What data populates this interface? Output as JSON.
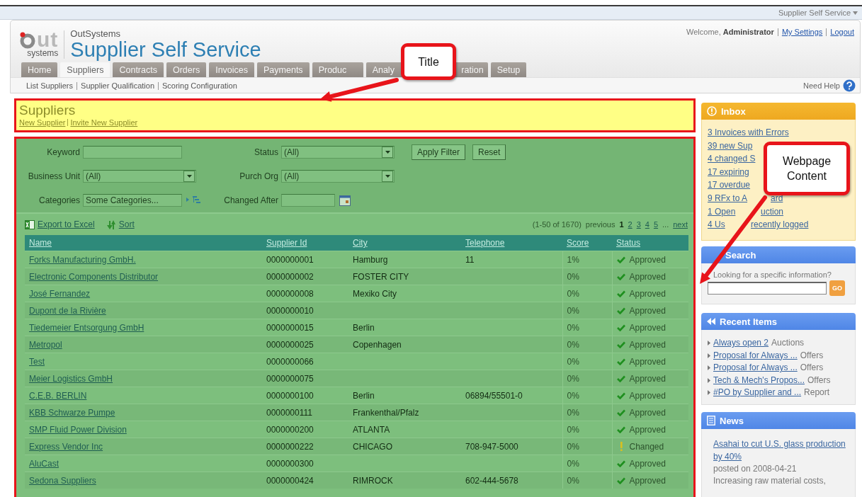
{
  "app_switcher": {
    "label": "Supplier Self Service"
  },
  "logo": {
    "mark": "ut",
    "caption": "systems"
  },
  "company": "OutSystems",
  "app_title": "Supplier Self Service",
  "user_bar": {
    "greeting": "Welcome,",
    "user": "Administrator",
    "links": [
      "My Settings",
      "Logout"
    ]
  },
  "tabs": [
    {
      "label": "Home",
      "selected": false
    },
    {
      "label": "Suppliers",
      "selected": true
    },
    {
      "label": "Contracts",
      "selected": false
    },
    {
      "label": "Orders",
      "selected": false
    },
    {
      "label": "Invoices",
      "selected": false
    },
    {
      "label": "Payments",
      "selected": false
    },
    {
      "label": "Produc",
      "selected": false,
      "kind": "cut_end"
    },
    {
      "label": "Analy",
      "selected": false,
      "kind": "cut_end"
    },
    {
      "label": "ration",
      "selected": false,
      "kind": "cut_start"
    },
    {
      "label": "Setup",
      "selected": false
    }
  ],
  "subnav": [
    "List Suppliers",
    "Supplier Qualification",
    "Scoring Configuration"
  ],
  "help": {
    "label": "Need Help"
  },
  "page": {
    "title": "Suppliers",
    "actions": [
      "New Supplier",
      "Invite New Supplier"
    ]
  },
  "filters": [
    {
      "label": "Keyword",
      "kind": "text"
    },
    {
      "label": "Status",
      "kind": "select",
      "value": "(All)"
    },
    {
      "label": "Business Unit",
      "kind": "select",
      "value": "(All)"
    },
    {
      "label": "Purch Org",
      "kind": "select",
      "value": "(All)"
    },
    {
      "label": "Categories",
      "kind": "picker",
      "value": "Some Categories..."
    },
    {
      "label": "Changed After",
      "kind": "date"
    }
  ],
  "filter_buttons": [
    "Apply Filter",
    "Reset"
  ],
  "toolbar": {
    "export": "Export to Excel",
    "sort": "Sort"
  },
  "pager": {
    "range": "(1-50 of 1670)",
    "previous": "previous",
    "pages": [
      {
        "label": "1",
        "selected": true
      },
      {
        "label": "2",
        "selected": false
      },
      {
        "label": "3",
        "selected": false
      },
      {
        "label": "4",
        "selected": false
      },
      {
        "label": "5",
        "selected": false
      }
    ],
    "ellipsis": "...",
    "next": "next"
  },
  "table": {
    "columns": [
      "Name",
      "Supplier Id",
      "City",
      "Telephone",
      "Score",
      "Status"
    ],
    "rows": [
      {
        "name": "Forks Manufacturing GmbH.",
        "id": "0000000001",
        "city": "Hamburg",
        "telephone": "11",
        "score": "1%",
        "status": "Approved",
        "kind": "approved"
      },
      {
        "name": "Electronic Components Distributor",
        "id": "0000000002",
        "city": "FOSTER CITY",
        "score": "0%",
        "status": "Approved",
        "kind": "approved"
      },
      {
        "name": "José Fernandez",
        "id": "0000000008",
        "city": "Mexiko City",
        "score": "0%",
        "status": "Approved",
        "kind": "approved"
      },
      {
        "name": "Dupont de la Rivière",
        "id": "0000000010",
        "score": "0%",
        "status": "Approved",
        "kind": "approved"
      },
      {
        "name": "Tiedemeier Entsorgung GmbH",
        "id": "0000000015",
        "city": "Berlin",
        "score": "0%",
        "status": "Approved",
        "kind": "approved"
      },
      {
        "name": "Metropol",
        "id": "0000000025",
        "city": "Copenhagen",
        "score": "0%",
        "status": "Approved",
        "kind": "approved"
      },
      {
        "name": "Test",
        "id": "0000000066",
        "score": "0%",
        "status": "Approved",
        "kind": "approved"
      },
      {
        "name": "Meier Logistics GmbH",
        "id": "0000000075",
        "score": "0%",
        "status": "Approved",
        "kind": "approved"
      },
      {
        "name": "C.E.B. BERLIN",
        "id": "0000000100",
        "city": "Berlin",
        "telephone": "06894/55501-0",
        "score": "0%",
        "status": "Approved",
        "kind": "approved"
      },
      {
        "name": "KBB Schwarze Pumpe",
        "id": "0000000111",
        "city": "Frankenthal/Pfalz",
        "score": "0%",
        "status": "Approved",
        "kind": "approved"
      },
      {
        "name": "SMP Fluid Power Division",
        "id": "0000000200",
        "city": "ATLANTA",
        "score": "0%",
        "status": "Approved",
        "kind": "approved"
      },
      {
        "name": "Express Vendor Inc",
        "id": "0000000222",
        "city": "CHICAGO",
        "telephone": "708-947-5000",
        "score": "0%",
        "status": "Changed",
        "kind": "changed"
      },
      {
        "name": "AluCast",
        "id": "0000000300",
        "score": "0%",
        "status": "Approved",
        "kind": "approved"
      },
      {
        "name": "Sedona Suppliers",
        "id": "0000000424",
        "city": "RIMROCK",
        "telephone": "602-444-5678",
        "score": "0%",
        "status": "Approved",
        "kind": "approved"
      }
    ]
  },
  "sidebar": {
    "inbox": {
      "title": "Inbox",
      "items": [
        [
          "3 Invoices with Errors"
        ],
        [
          "39 new Sup"
        ],
        [
          "4 changed S"
        ],
        [
          "17 expiring"
        ],
        [
          "17 overdue"
        ],
        [
          "9 RFx to A",
          "ard"
        ],
        [
          "1 Open",
          "uction"
        ],
        [
          "4 Us",
          "recently logged"
        ]
      ]
    },
    "search": {
      "title": "Search",
      "prompt": "Looking for a specific information?",
      "button": "GO"
    },
    "recent": {
      "title": "Recent Items",
      "items": [
        {
          "link": "Always open 2",
          "type": "Auctions"
        },
        {
          "link": "Proposal for Always ...",
          "type": "Offers"
        },
        {
          "link": "Proposal for Always ...",
          "type": "Offers"
        },
        {
          "link": "Tech & Mech's Propos...",
          "type": "Offers"
        },
        {
          "link": "#PO by Supplier and ...",
          "type": "Report"
        }
      ]
    },
    "news": {
      "title": "News",
      "items": [
        {
          "headline": "Asahai to cut U.S. glass production by 40%",
          "date": "posted on 2008-04-21",
          "excerpt": "Increasing raw material costs,"
        }
      ]
    }
  },
  "callouts": [
    {
      "text": "Title"
    },
    {
      "text": "Webpage Content"
    }
  ]
}
